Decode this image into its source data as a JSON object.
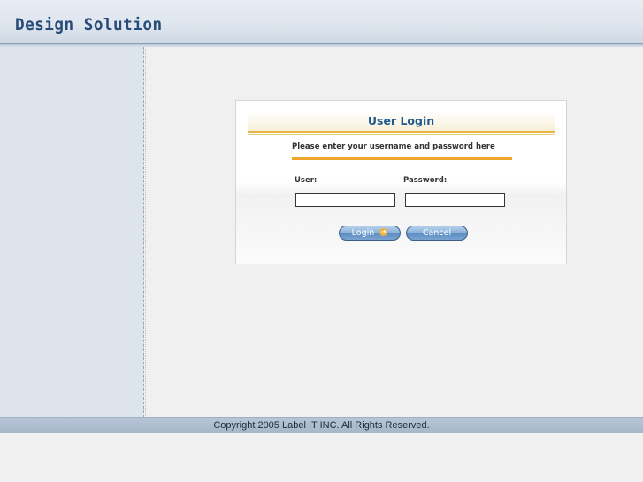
{
  "header": {
    "logo_text": "Design Solution"
  },
  "login": {
    "title": "User Login",
    "instruction": "Please enter your username and password here",
    "user_label": "User:",
    "password_label": "Password:",
    "user_value": "",
    "password_value": "",
    "login_button": "Login",
    "cancel_button": "Cancel",
    "login_icon": "arrow-right-icon"
  },
  "footer": {
    "copyright": "Copyright 2005 Label IT INC. All Rights Reserved."
  },
  "colors": {
    "header_bg": "#dfe6ee",
    "logo": "#274c7a",
    "sidebar_bg": "#dde4ec",
    "accent_orange": "#eea72a",
    "title_blue": "#1f5a8f",
    "button_blue": "#7aa4d2",
    "footer_bg": "#a5b7ca"
  }
}
